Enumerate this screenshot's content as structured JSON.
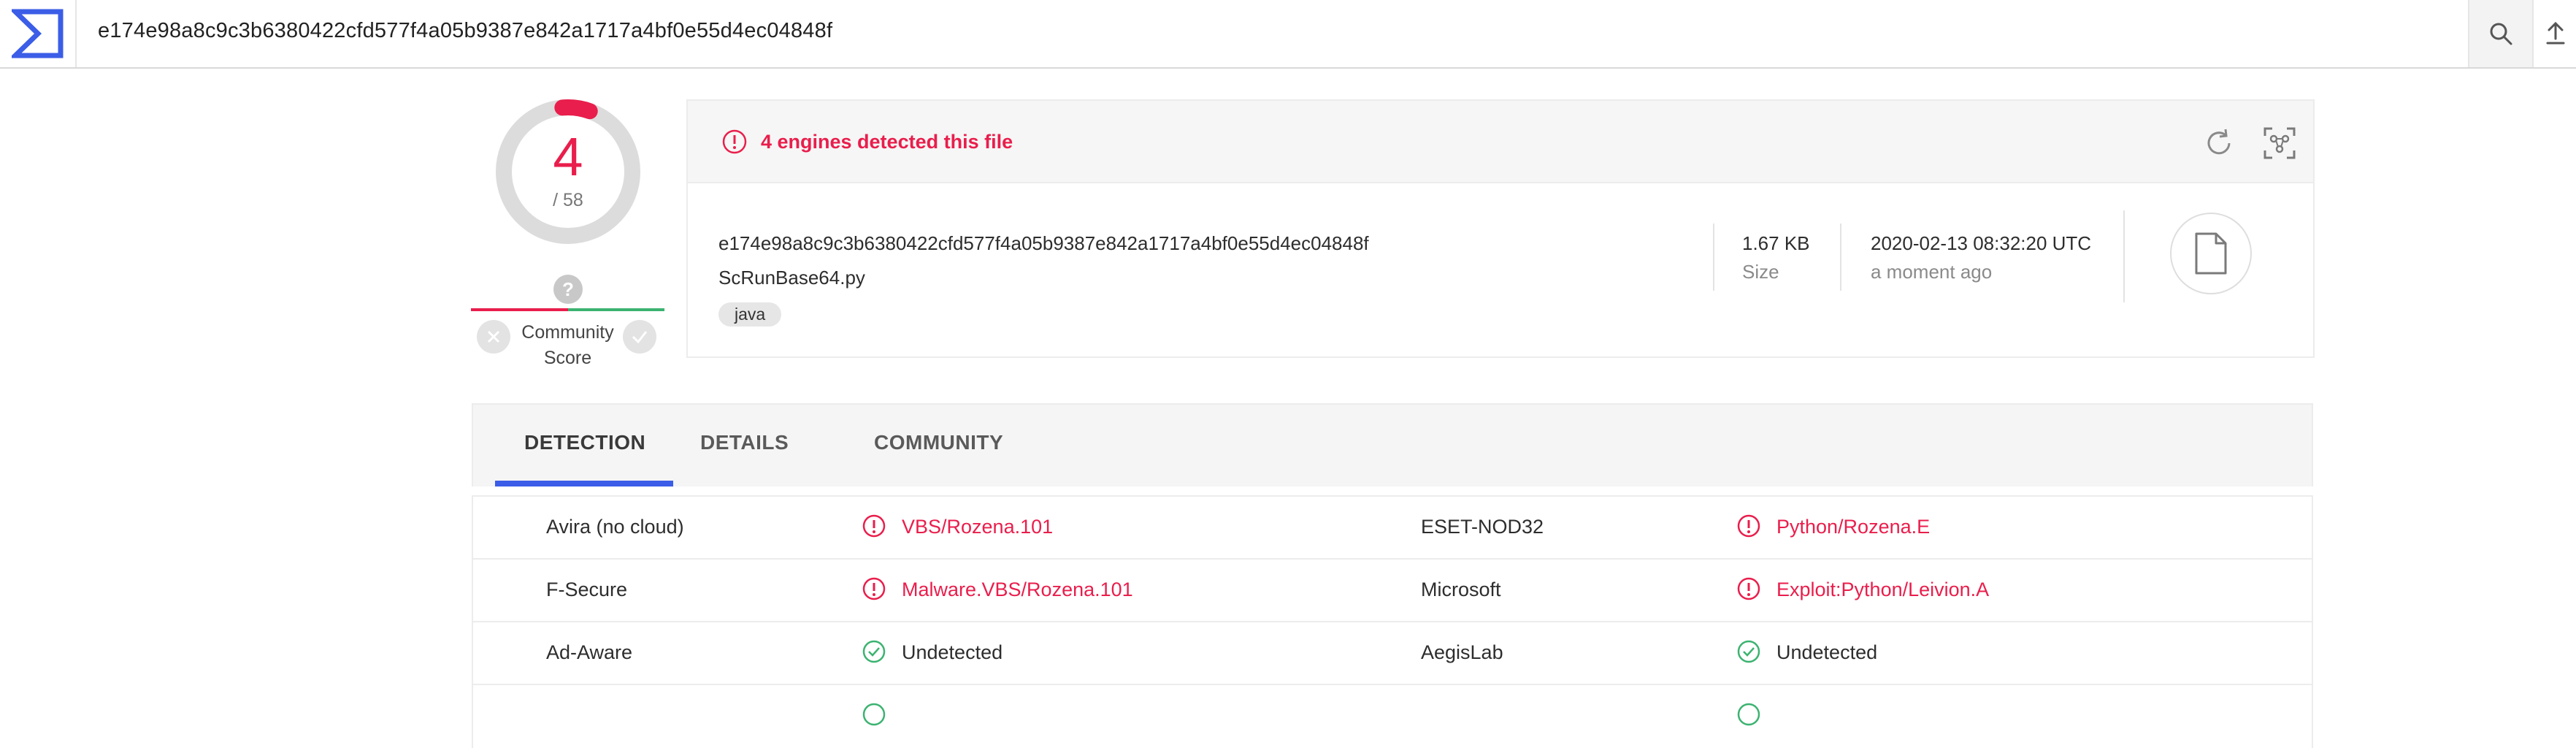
{
  "search": {
    "value": "e174e98a8c9c3b6380422cfd577f4a05b9387e842a1717a4bf0e55d4ec04848f"
  },
  "score": {
    "detections": "4",
    "total": "/ 58"
  },
  "community": {
    "unknown_symbol": "?",
    "label_line1": "Community",
    "label_line2": "Score"
  },
  "summary": {
    "alert_text": "4 engines detected this file",
    "file_hash": "e174e98a8c9c3b6380422cfd577f4a05b9387e842a1717a4bf0e55d4ec04848f",
    "file_name": "ScRunBase64.py",
    "tags": [
      "java"
    ],
    "size_value": "1.67 KB",
    "size_label": "Size",
    "date_value": "2020-02-13 08:32:20 UTC",
    "date_label": "a moment ago"
  },
  "tabs": [
    {
      "label": "DETECTION",
      "active": true
    },
    {
      "label": "DETAILS",
      "active": false
    },
    {
      "label": "COMMUNITY",
      "active": false
    }
  ],
  "detections": [
    {
      "left_engine": "Avira (no cloud)",
      "left_result": "VBS/Rozena.101",
      "left_status": "malicious",
      "right_engine": "ESET-NOD32",
      "right_result": "Python/Rozena.E",
      "right_status": "malicious"
    },
    {
      "left_engine": "F-Secure",
      "left_result": "Malware.VBS/Rozena.101",
      "left_status": "malicious",
      "right_engine": "Microsoft",
      "right_result": "Exploit:Python/Leivion.A",
      "right_status": "malicious"
    },
    {
      "left_engine": "Ad-Aware",
      "left_result": "Undetected",
      "left_status": "clean",
      "right_engine": "AegisLab",
      "right_result": "Undetected",
      "right_status": "clean"
    }
  ],
  "colors": {
    "malicious": "#e91e4c",
    "clean": "#3cb371",
    "accent": "#3b5de7"
  },
  "icons": {
    "logo": "virustotal-sigma-logo",
    "search": "search-icon",
    "upload": "upload-icon",
    "alert": "alert-circle-icon",
    "reanalyze": "refresh-icon",
    "similar": "similar-files-icon",
    "file": "file-icon",
    "check": "check-circle-icon"
  }
}
